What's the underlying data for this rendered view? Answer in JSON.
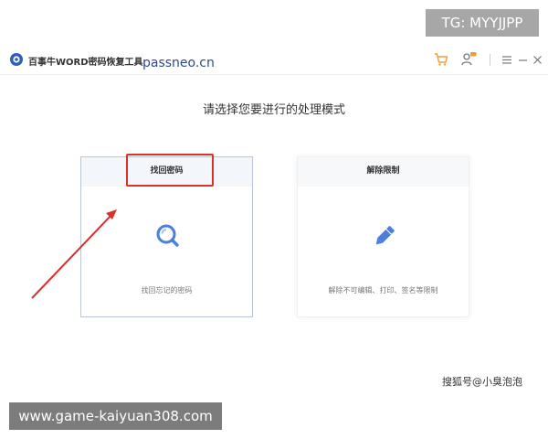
{
  "badge": {
    "text": "TG: MYYJJPP"
  },
  "app": {
    "title": "百事牛WORD密码恢复工具",
    "site": "passneo.cn"
  },
  "titlebar_icons": [
    "cart-icon",
    "user-icon",
    "menu-icon",
    "minimize-icon",
    "close-icon"
  ],
  "main": {
    "prompt": "请选择您要进行的处理模式",
    "cards": [
      {
        "title": "找回密码",
        "description": "找回忘记的密码",
        "icon": "magnifier-icon"
      },
      {
        "title": "解除限制",
        "description": "解除不可编辑、打印、签名等限制",
        "icon": "pencil-icon"
      }
    ]
  },
  "overlays": {
    "watermark": "搜狐号@小臭泡泡",
    "banner": "www.game-kaiyuan308.com"
  },
  "colors": {
    "accent_blue": "#4a7fe0",
    "cart_orange": "#f29b38",
    "annotation_red": "#d9312b",
    "site_text": "#2d4a8a"
  }
}
